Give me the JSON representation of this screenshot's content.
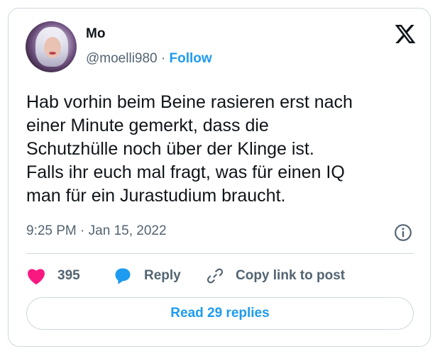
{
  "author": {
    "name": "Mo",
    "handle": "@moelli980",
    "separator": "·",
    "follow_label": "Follow"
  },
  "tweet": {
    "text": "Hab vorhin beim Beine rasieren erst nach\neiner Minute gemerkt, dass die\nSchutzhülle noch über der Klinge ist.\nFalls ihr euch mal fragt, was für einen IQ\nman für ein Jurastudium braucht.",
    "time": "9:25 PM",
    "date_separator": "·",
    "date": "Jan 15, 2022"
  },
  "actions": {
    "likes_count": "395",
    "reply_label": "Reply",
    "copy_label": "Copy link to post"
  },
  "read_replies_label": "Read 29 replies",
  "icons": {
    "logo": "x-logo-icon",
    "info": "info-icon",
    "like": "heart-icon",
    "reply": "speech-bubble-icon",
    "copy": "link-icon"
  },
  "colors": {
    "accent": "#1d9bf0",
    "like": "#f91880",
    "text": "#0f1419",
    "secondary": "#536471",
    "border": "#cfd9de"
  }
}
